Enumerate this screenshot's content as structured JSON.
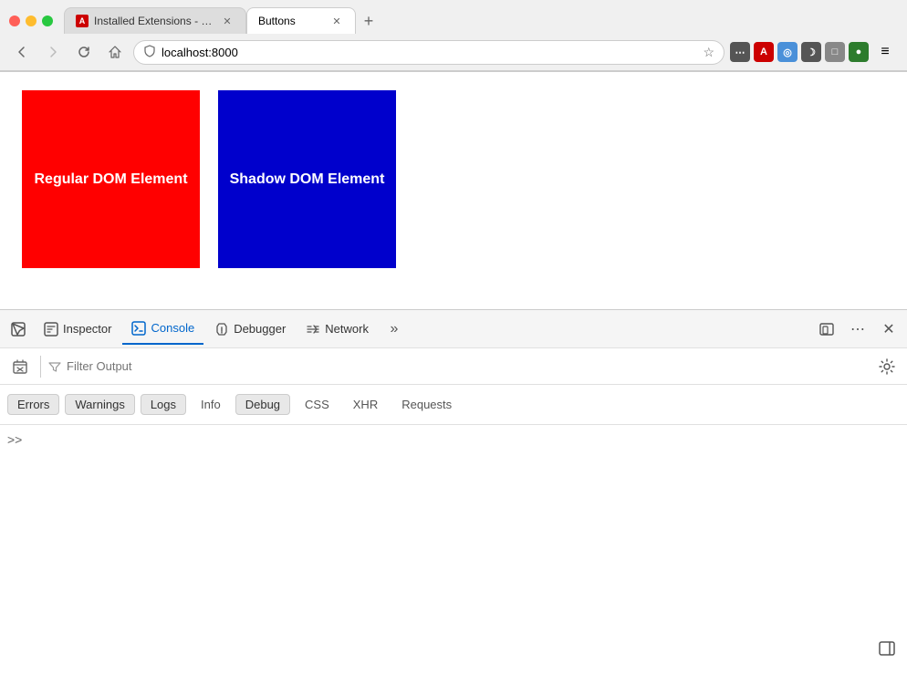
{
  "browser": {
    "tabs": [
      {
        "id": "tab-1",
        "title": "Installed Extensions - Data Colle",
        "favicon_color": "#cc0000",
        "favicon_letter": "A",
        "active": false
      },
      {
        "id": "tab-2",
        "title": "Buttons",
        "favicon_color": null,
        "active": true
      }
    ],
    "new_tab_label": "+",
    "nav": {
      "back_disabled": false,
      "forward_disabled": false,
      "url": "localhost:8000"
    }
  },
  "page": {
    "boxes": [
      {
        "id": "regular",
        "label": "Regular DOM Element",
        "color": "#ff0000"
      },
      {
        "id": "shadow",
        "label": "Shadow DOM Element",
        "color": "#0000cc"
      }
    ]
  },
  "devtools": {
    "tools": [
      {
        "id": "picker",
        "label": "",
        "icon": "picker",
        "active": false
      },
      {
        "id": "inspector",
        "label": "Inspector",
        "active": false
      },
      {
        "id": "console",
        "label": "Console",
        "active": true
      },
      {
        "id": "debugger",
        "label": "Debugger",
        "active": false
      },
      {
        "id": "network",
        "label": "Network",
        "active": false
      }
    ],
    "filter_placeholder": "Filter Output",
    "filter_chips": [
      {
        "id": "errors",
        "label": "Errors",
        "active": true
      },
      {
        "id": "warnings",
        "label": "Warnings",
        "active": true
      },
      {
        "id": "logs",
        "label": "Logs",
        "active": true
      },
      {
        "id": "info",
        "label": "Info",
        "active": false
      },
      {
        "id": "debug",
        "label": "Debug",
        "active": true
      },
      {
        "id": "css",
        "label": "CSS",
        "active": false
      },
      {
        "id": "xhr",
        "label": "XHR",
        "active": false
      },
      {
        "id": "requests",
        "label": "Requests",
        "active": false
      }
    ],
    "console_prompt": ">>",
    "colors": {
      "active_tab": "#0066cc",
      "active_tab_underline": "#0066cc"
    }
  }
}
